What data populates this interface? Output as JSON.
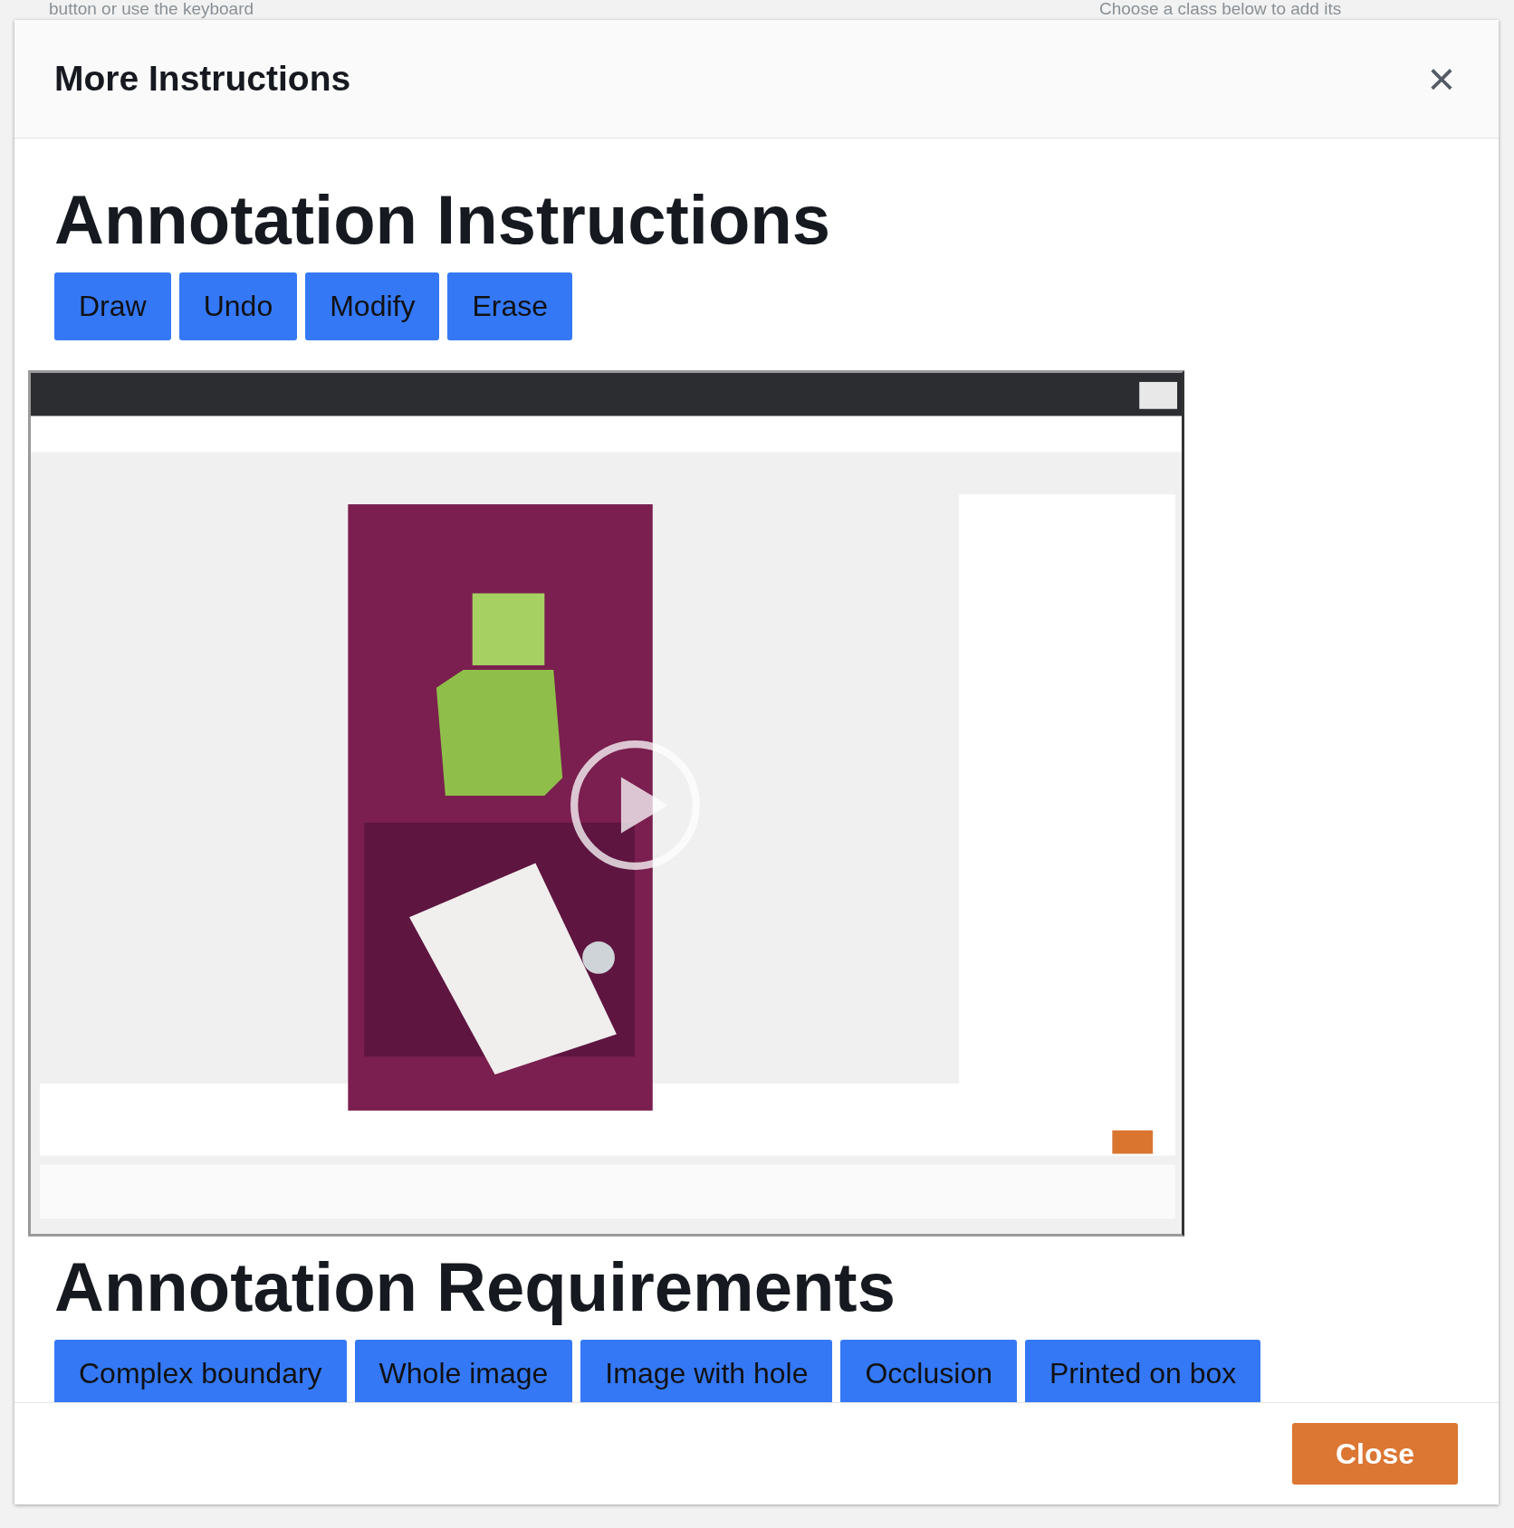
{
  "background": {
    "texts": [
      "button or use the keyboard",
      "Choose a class below to add its"
    ]
  },
  "modal": {
    "title": "More Instructions",
    "close_icon": "×",
    "sections": [
      {
        "heading": "Annotation Instructions",
        "buttons": [
          "Draw",
          "Undo",
          "Modify",
          "Erase"
        ],
        "media": {
          "kind": "picture"
        }
      },
      {
        "heading": "Annotation Requirements",
        "buttons": [
          "Complex boundary",
          "Whole image",
          "Image with hole",
          "Occlusion",
          "Printed on box"
        ]
      }
    ],
    "footer_button": "Close"
  }
}
